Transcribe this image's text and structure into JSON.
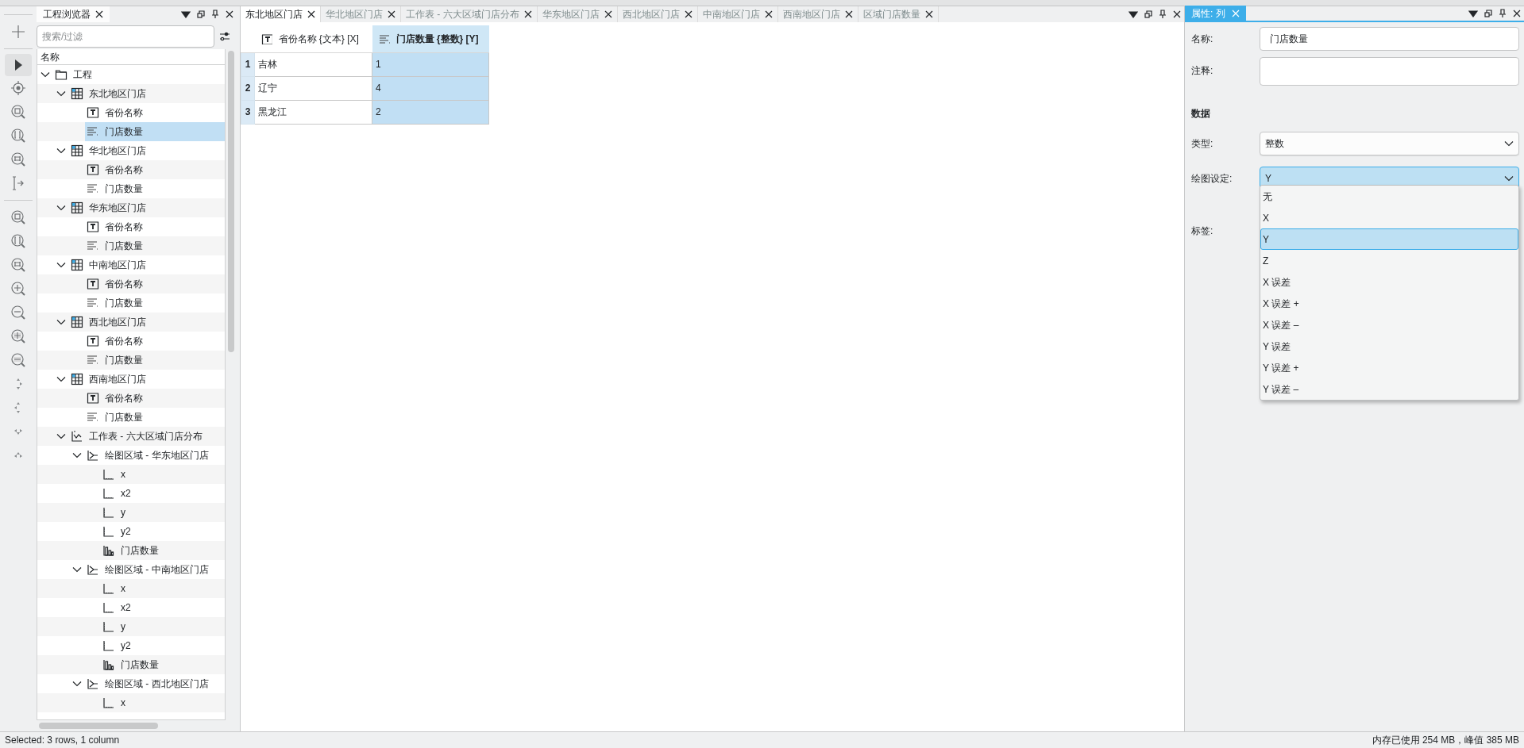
{
  "project_explorer": {
    "title": "工程浏览器",
    "search": {
      "placeholder": "搜索/过滤"
    },
    "tree_header": "名称",
    "items": [
      {
        "label": "工程",
        "kind": "folder",
        "expanded": true,
        "selected": false,
        "children": [
          {
            "label": "东北地区门店",
            "kind": "table",
            "expanded": true,
            "selected": false,
            "children": [
              {
                "label": "省份名称",
                "kind": "text-column",
                "selected": false
              },
              {
                "label": "门店数量",
                "kind": "number-column",
                "selected": true
              }
            ]
          },
          {
            "label": "华北地区门店",
            "kind": "table",
            "expanded": true,
            "selected": false,
            "children": [
              {
                "label": "省份名称",
                "kind": "text-column",
                "selected": false
              },
              {
                "label": "门店数量",
                "kind": "number-column",
                "selected": false
              }
            ]
          },
          {
            "label": "华东地区门店",
            "kind": "table",
            "expanded": true,
            "selected": false,
            "children": [
              {
                "label": "省份名称",
                "kind": "text-column",
                "selected": false
              },
              {
                "label": "门店数量",
                "kind": "number-column",
                "selected": false
              }
            ]
          },
          {
            "label": "中南地区门店",
            "kind": "table",
            "expanded": true,
            "selected": false,
            "children": [
              {
                "label": "省份名称",
                "kind": "text-column",
                "selected": false
              },
              {
                "label": "门店数量",
                "kind": "number-column",
                "selected": false
              }
            ]
          },
          {
            "label": "西北地区门店",
            "kind": "table",
            "expanded": true,
            "selected": false,
            "children": [
              {
                "label": "省份名称",
                "kind": "text-column",
                "selected": false
              },
              {
                "label": "门店数量",
                "kind": "number-column",
                "selected": false
              }
            ]
          },
          {
            "label": "西南地区门店",
            "kind": "table",
            "expanded": true,
            "selected": false,
            "children": [
              {
                "label": "省份名称",
                "kind": "text-column",
                "selected": false
              },
              {
                "label": "门店数量",
                "kind": "number-column",
                "selected": false
              }
            ]
          },
          {
            "label": "工作表 - 六大区域门店分布",
            "kind": "worksheet",
            "expanded": true,
            "selected": false,
            "children": [
              {
                "label": "绘图区域 - 华东地区门店",
                "kind": "plot",
                "expanded": true,
                "selected": false,
                "children": [
                  {
                    "label": "x",
                    "kind": "axis-x",
                    "selected": false
                  },
                  {
                    "label": "x2",
                    "kind": "axis-x",
                    "selected": false
                  },
                  {
                    "label": "y",
                    "kind": "axis-y",
                    "selected": false
                  },
                  {
                    "label": "y2",
                    "kind": "axis-y",
                    "selected": false
                  },
                  {
                    "label": "门店数量",
                    "kind": "bar-series",
                    "selected": false
                  }
                ]
              },
              {
                "label": "绘图区域 - 中南地区门店",
                "kind": "plot",
                "expanded": true,
                "selected": false,
                "children": [
                  {
                    "label": "x",
                    "kind": "axis-x",
                    "selected": false
                  },
                  {
                    "label": "x2",
                    "kind": "axis-x",
                    "selected": false
                  },
                  {
                    "label": "y",
                    "kind": "axis-y",
                    "selected": false
                  },
                  {
                    "label": "y2",
                    "kind": "axis-y",
                    "selected": false
                  },
                  {
                    "label": "门店数量",
                    "kind": "bar-series",
                    "selected": false
                  }
                ]
              },
              {
                "label": "绘图区域 - 西北地区门店",
                "kind": "plot",
                "expanded": true,
                "selected": false,
                "children": [
                  {
                    "label": "x",
                    "kind": "axis-x",
                    "selected": false
                  }
                ]
              }
            ]
          }
        ]
      }
    ]
  },
  "tabs": [
    {
      "label": "东北地区门店",
      "selected": true
    },
    {
      "label": "华北地区门店",
      "selected": false
    },
    {
      "label": "工作表 - 六大区域门店分布",
      "selected": false
    },
    {
      "label": "华东地区门店",
      "selected": false
    },
    {
      "label": "西北地区门店",
      "selected": false
    },
    {
      "label": "中南地区门店",
      "selected": false
    },
    {
      "label": "西南地区门店",
      "selected": false
    },
    {
      "label": "区域门店数量",
      "selected": false
    }
  ],
  "table": {
    "columns": [
      {
        "label": "省份名称 {文本} [X]",
        "kind": "text-column",
        "selected": false
      },
      {
        "label": "门店数量 {整数} [Y]",
        "kind": "number-column",
        "selected": true
      }
    ],
    "rows": [
      {
        "number": "1",
        "cells": [
          "吉林",
          "1"
        ]
      },
      {
        "number": "2",
        "cells": [
          "辽宁",
          "4"
        ]
      },
      {
        "number": "3",
        "cells": [
          "黑龙江",
          "2"
        ]
      }
    ]
  },
  "properties": {
    "title": "属性: 列",
    "fields": [
      {
        "kind": "text",
        "label": "名称:",
        "value": "门店数量"
      },
      {
        "kind": "textarea",
        "label": "注释:"
      },
      {
        "kind": "heading",
        "label": "数据"
      },
      {
        "kind": "select",
        "label": "类型:",
        "value": "整数",
        "expanded": false
      },
      {
        "kind": "select",
        "label": "绘图设定:",
        "value": "Y",
        "expanded": true,
        "options": [
          {
            "label": "无",
            "selected": false
          },
          {
            "label": "X",
            "selected": false
          },
          {
            "label": "Y",
            "selected": true
          },
          {
            "label": "Z",
            "selected": false
          },
          {
            "label": "X 误差",
            "selected": false
          },
          {
            "label": "X 误差 +",
            "selected": false
          },
          {
            "label": "X 误差 –",
            "selected": false
          },
          {
            "label": "Y 误差",
            "selected": false
          },
          {
            "label": "Y 误差 +",
            "selected": false
          },
          {
            "label": "Y 误差 –",
            "selected": false
          }
        ]
      },
      {
        "kind": "label",
        "label": "标签:"
      }
    ]
  },
  "status_bar": {
    "left": "Selected: 3 rows, 1 column",
    "right": "内存已使用 254 MB，峰值 385 MB"
  }
}
